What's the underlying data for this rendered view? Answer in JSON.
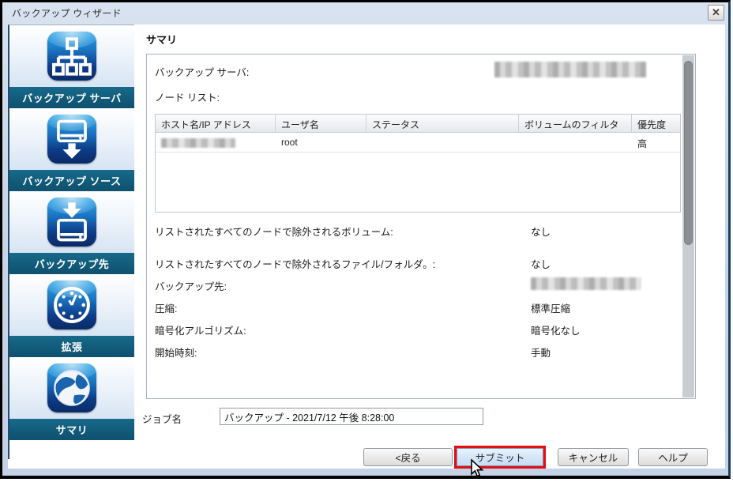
{
  "window": {
    "title": "バックアップ ウィザード",
    "close_glyph": "✕"
  },
  "sidebar": {
    "steps": [
      {
        "label": "バックアップ サーバ",
        "icon": "network-tree-icon"
      },
      {
        "label": "バックアップ ソース",
        "icon": "disk-download-icon"
      },
      {
        "label": "バックアップ先",
        "icon": "disk-receive-icon"
      },
      {
        "label": "拡張",
        "icon": "clock-icon"
      },
      {
        "label": "サマリ",
        "icon": "globe-icon"
      }
    ]
  },
  "main": {
    "heading": "サマリ",
    "summary": {
      "backup_server_label": "バックアップ サーバ:",
      "backup_server_value_redacted": true,
      "node_list_label": "ノード リスト:",
      "table": {
        "headers": [
          "ホスト名/IP アドレス",
          "ユーザ名",
          "ステータス",
          "ボリュームのフィルタ",
          "優先度"
        ],
        "row": {
          "host_redacted": true,
          "user": "root",
          "status": "",
          "volume_filter": "",
          "priority": "高"
        }
      },
      "rows": [
        {
          "label": "リストされたすべてのノードで除外されるボリューム:",
          "value": "なし"
        },
        {
          "label": "リストされたすべてのノードで除外されるファイル/フォルダ。:",
          "value": "なし"
        },
        {
          "label": "バックアップ先:",
          "value": "",
          "redacted": true
        },
        {
          "label": "圧縮:",
          "value": "標準圧縮"
        },
        {
          "label": "暗号化アルゴリズム:",
          "value": "暗号化なし"
        },
        {
          "label": "開始時刻:",
          "value": "手動"
        }
      ]
    },
    "job_name": {
      "label": "ジョブ名",
      "value": "バックアップ - 2021/7/12 午後 8:28:00"
    }
  },
  "footer": {
    "back_label": "<戻る",
    "submit_label": "サブミット",
    "cancel_label": "キャンセル",
    "help_label": "ヘルプ"
  },
  "colors": {
    "step_band_teal": "#115A78",
    "icon_blue": "#1A73C2",
    "titlebar_blue": "#C8D6E6",
    "annotation_red": "#E30F13",
    "submit_fill": "#D4E6F7"
  }
}
